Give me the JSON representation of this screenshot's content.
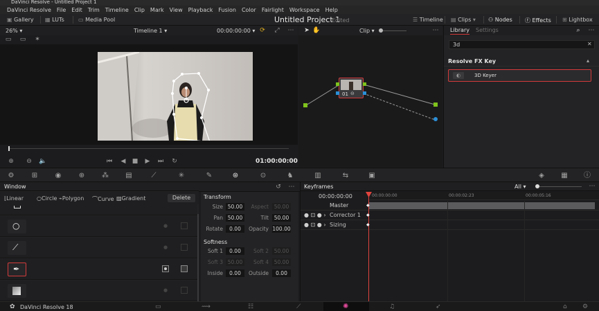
{
  "window": {
    "title": "DaVinci Resolve - Untitled Project 1"
  },
  "menu": [
    "DaVinci Resolve",
    "File",
    "Edit",
    "Trim",
    "Timeline",
    "Clip",
    "Mark",
    "View",
    "Playback",
    "Fusion",
    "Color",
    "Fairlight",
    "Workspace",
    "Help"
  ],
  "toolbar": {
    "gallery": "Gallery",
    "luts": "LUTs",
    "media_pool": "Media Pool",
    "project_title": "Untitled Project 1",
    "edited": "Edited",
    "timeline": "Timeline",
    "clips": "Clips",
    "nodes": "Nodes",
    "effects": "Effects",
    "lightbox": "Lightbox"
  },
  "viewer": {
    "zoom": "26%",
    "timeline_name": "Timeline 1",
    "timecode_top": "00:00:00:00",
    "timecode": "01:00:00:00"
  },
  "node_editor": {
    "mode": "Clip",
    "node_label": "01"
  },
  "library": {
    "tab_library": "Library",
    "tab_settings": "Settings",
    "search_value": "3d",
    "section": "Resolve FX Key",
    "item": "3D Keyer"
  },
  "window_panel": {
    "title": "Window",
    "shapes": {
      "linear": "Linear",
      "circle": "Circle",
      "polygon": "Polygon",
      "curve": "Curve",
      "gradient": "Gradient"
    },
    "delete": "Delete"
  },
  "transform": {
    "title": "Transform",
    "size_label": "Size",
    "size": "50.00",
    "aspect_label": "Aspect",
    "aspect": "50.00",
    "pan_label": "Pan",
    "pan": "50.00",
    "tilt_label": "Tilt",
    "tilt": "50.00",
    "rotate_label": "Rotate",
    "rotate": "0.00",
    "opacity_label": "Opacity",
    "opacity": "100.00",
    "softness_title": "Softness",
    "soft1_label": "Soft 1",
    "soft1": "0.00",
    "soft2_label": "Soft 2",
    "soft2": "50.00",
    "soft3_label": "Soft 3",
    "soft3": "50.00",
    "soft4_label": "Soft 4",
    "soft4": "50.00",
    "inside_label": "Inside",
    "inside": "0.00",
    "outside_label": "Outside",
    "outside": "0.00"
  },
  "keyframes": {
    "title": "Keyframes",
    "filter": "All",
    "timecode": "00:00:00:00",
    "ruler": [
      "00:00:00:00",
      "00:00:02:23",
      "00:00:05:16"
    ],
    "tracks": {
      "master": "Master",
      "corrector": "Corrector 1",
      "sizing": "Sizing"
    }
  },
  "footer": {
    "app_name": "DaVinci Resolve 18"
  },
  "colors": {
    "accent_red": "#d33a3a",
    "playhead": "#e0443e",
    "node_green": "#7fc31c",
    "node_blue": "#2b8fd6"
  }
}
